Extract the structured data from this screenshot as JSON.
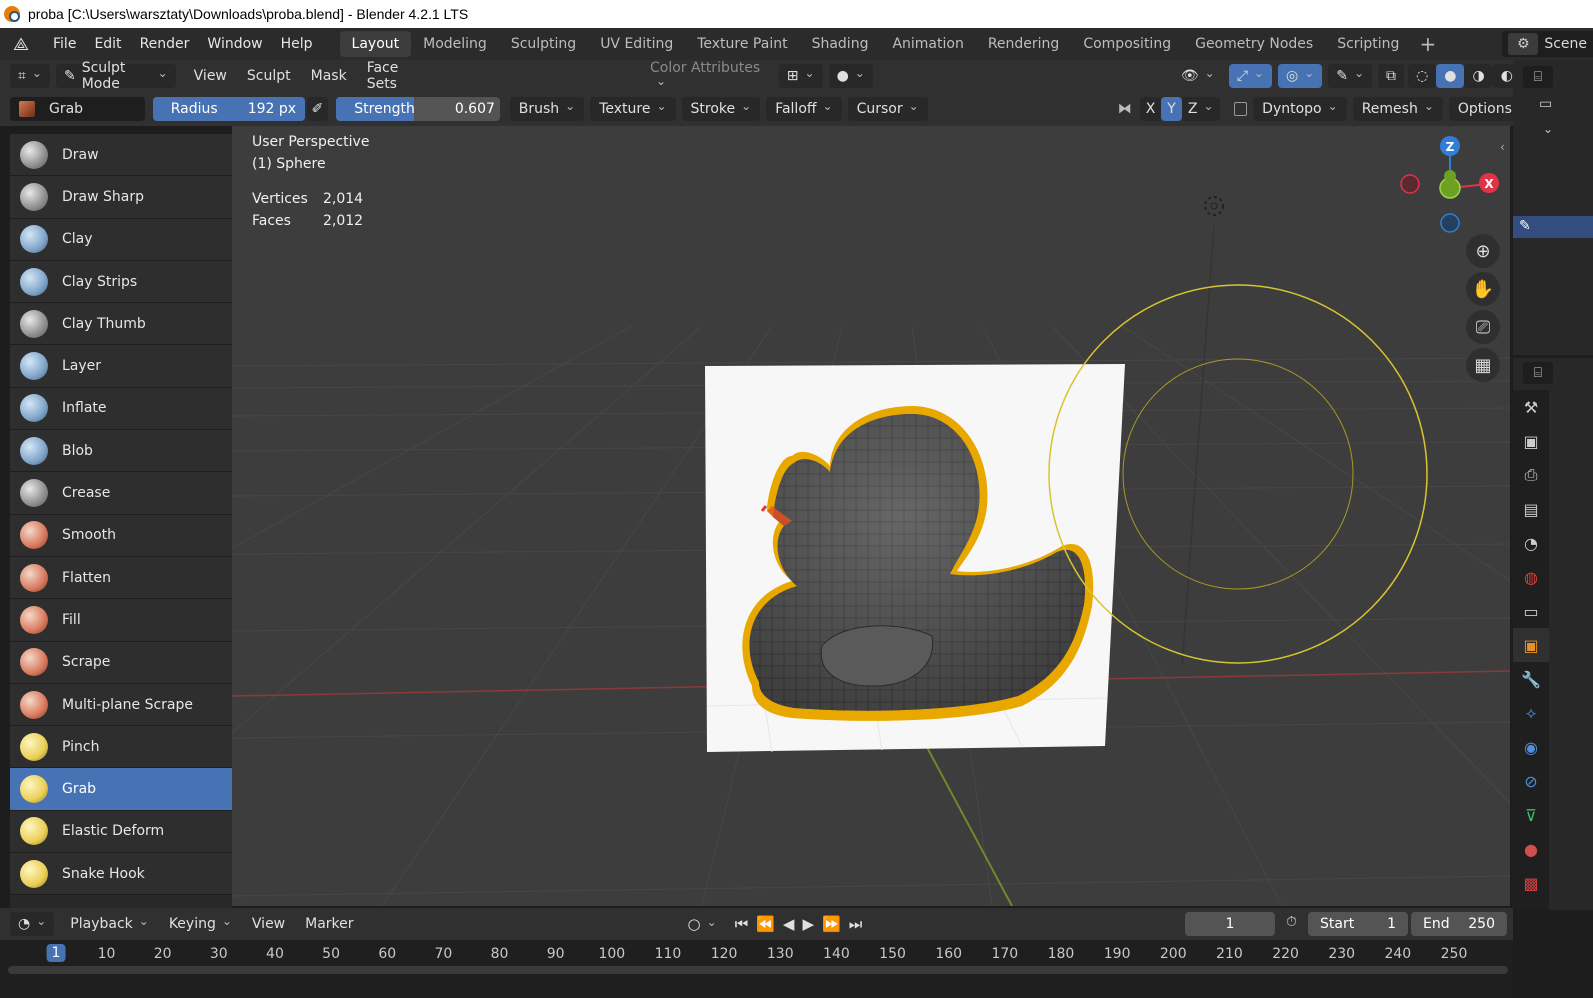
{
  "window": {
    "title": "proba [C:\\Users\\warsztaty\\Downloads\\proba.blend] - Blender 4.2.1 LTS"
  },
  "menu": {
    "items": [
      "File",
      "Edit",
      "Render",
      "Window",
      "Help"
    ],
    "workspaces": [
      "Layout",
      "Modeling",
      "Sculpting",
      "UV Editing",
      "Texture Paint",
      "Shading",
      "Animation",
      "Rendering",
      "Compositing",
      "Geometry Nodes",
      "Scripting"
    ],
    "active_workspace": "Layout",
    "scene_label": "Scene"
  },
  "header": {
    "mode": "Sculpt Mode",
    "menus": [
      "View",
      "Sculpt",
      "Mask",
      "Face Sets"
    ],
    "color_attributes": "Color Attributes"
  },
  "tool_settings": {
    "brush_name": "Grab",
    "radius_label": "Radius",
    "radius_value": "192 px",
    "strength_label": "Strength",
    "strength_value": "0.607",
    "strength_fraction": 0.607,
    "buttons": [
      "Brush",
      "Texture",
      "Stroke",
      "Falloff",
      "Cursor"
    ],
    "axes": [
      "X",
      "Y",
      "Z"
    ],
    "active_axis": "Y",
    "dyntopo": "Dyntopo",
    "remesh": "Remesh",
    "options": "Options"
  },
  "brushes": [
    {
      "label": "Draw",
      "tone": "grey"
    },
    {
      "label": "Draw Sharp",
      "tone": "grey"
    },
    {
      "label": "Clay",
      "tone": "blue"
    },
    {
      "label": "Clay Strips",
      "tone": "blue"
    },
    {
      "label": "Clay Thumb",
      "tone": "grey"
    },
    {
      "label": "Layer",
      "tone": "blue"
    },
    {
      "label": "Inflate",
      "tone": "blue"
    },
    {
      "label": "Blob",
      "tone": "blue"
    },
    {
      "label": "Crease",
      "tone": "grey"
    },
    {
      "label": "Smooth",
      "tone": "warm"
    },
    {
      "label": "Flatten",
      "tone": "warm"
    },
    {
      "label": "Fill",
      "tone": "warm"
    },
    {
      "label": "Scrape",
      "tone": "warm"
    },
    {
      "label": "Multi-plane Scrape",
      "tone": "warm"
    },
    {
      "label": "Pinch",
      "tone": "yellow"
    },
    {
      "label": "Grab",
      "tone": "yellow"
    },
    {
      "label": "Elastic Deform",
      "tone": "yellow"
    },
    {
      "label": "Snake Hook",
      "tone": "yellow"
    }
  ],
  "active_brush": "Grab",
  "viewport": {
    "perspective": "User Perspective",
    "object": "(1) Sphere",
    "vertices_label": "Vertices",
    "vertices_value": "2,014",
    "faces_label": "Faces",
    "faces_value": "2,012",
    "gizmo_axes": [
      "Z",
      "Y",
      "X"
    ]
  },
  "timeline": {
    "menus": [
      "Playback",
      "Keying",
      "View",
      "Marker"
    ],
    "current_frame": "1",
    "start_label": "Start",
    "start_value": "1",
    "end_label": "End",
    "end_value": "250",
    "frame_ticks": [
      "1",
      "10",
      "20",
      "30",
      "40",
      "50",
      "60",
      "70",
      "80",
      "90",
      "100",
      "110",
      "120",
      "130",
      "140",
      "150",
      "160",
      "170",
      "180",
      "190",
      "200",
      "210",
      "220",
      "230",
      "240",
      "250"
    ]
  },
  "colors": {
    "accent": "#4772b3",
    "outline": "#e8a800",
    "brush_circle": "#d7c52e",
    "axis_x": "#e0334a",
    "axis_y": "#6ca122",
    "axis_z": "#2f7fd8"
  }
}
